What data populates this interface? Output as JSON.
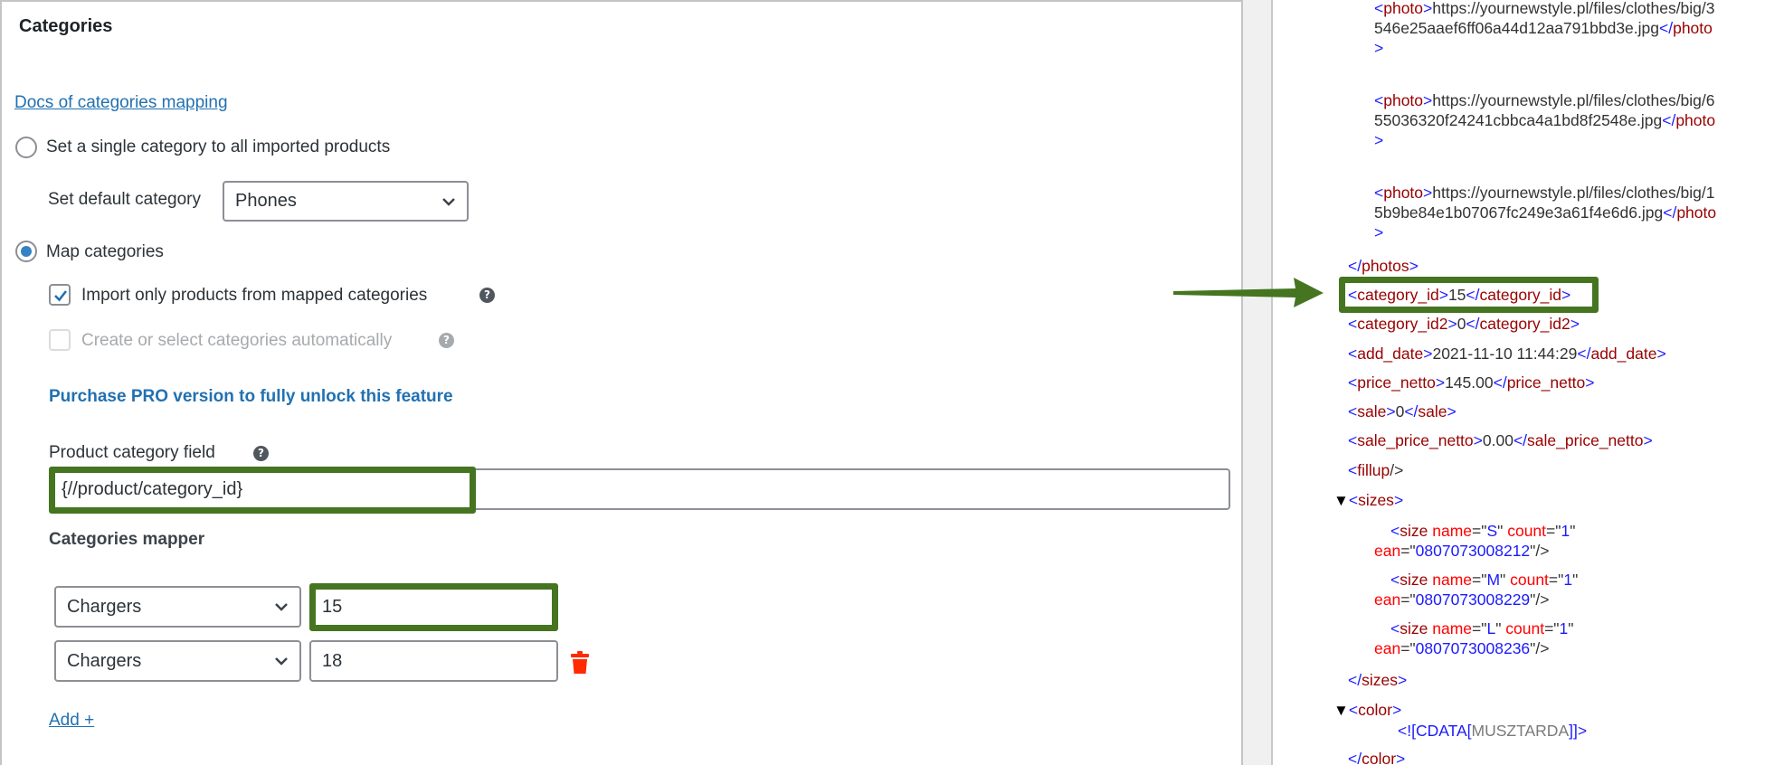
{
  "left": {
    "title": "Categories",
    "docs_link": "Docs of categories mapping",
    "radio_single": {
      "label": "Set a single category to all imported products",
      "checked": false
    },
    "default_category": {
      "label": "Set default category",
      "value": "Phones"
    },
    "radio_map": {
      "label": "Map categories",
      "checked": true
    },
    "checkbox_mapped_only": {
      "label": "Import only products from mapped categories",
      "checked": true
    },
    "checkbox_auto": {
      "label": "Create or select categories automatically",
      "checked": false,
      "disabled": true
    },
    "pro_notice": "Purchase PRO version to fully unlock this feature",
    "product_category_field": {
      "label": "Product category field",
      "value": "{//product/category_id}"
    },
    "mapper": {
      "heading": "Categories mapper",
      "rows": [
        {
          "category": "Chargers",
          "value": "15"
        },
        {
          "category": "Chargers",
          "value": "18"
        }
      ],
      "add_label": "Add +"
    },
    "help_glyph": "?"
  },
  "xml": {
    "photos": [
      {
        "tag": "photo",
        "line1": "https://yournewstyle.pl/files/clothes/big/3",
        "line2": "546e25aaef6ff06a44d12aa791bbd3e.jpg",
        "close_partial": "photo",
        "close_end": ">"
      },
      {
        "tag": "photo",
        "line1": "https://yournewstyle.pl/files/clothes/big/6",
        "line2": "55036320f24241cbbca4a1bd8f2548e.jpg",
        "close_partial": "photo",
        "close_end": ">"
      },
      {
        "tag": "photo",
        "line1": "https://yournewstyle.pl/files/clothes/big/1",
        "line2": "5b9be84e1b07067fc249e3a61f4e6d6.jpg",
        "close_partial": "photo",
        "close_end": ">"
      }
    ],
    "photos_close": "photos",
    "elements": [
      {
        "tag": "category_id",
        "value": "15"
      },
      {
        "tag": "category_id2",
        "value": "0"
      },
      {
        "tag": "add_date",
        "value": "2021-11-10 11:44:29"
      },
      {
        "tag": "price_netto",
        "value": "145.00"
      },
      {
        "tag": "sale",
        "value": "0"
      },
      {
        "tag": "sale_price_netto",
        "value": "0.00"
      }
    ],
    "fillup": "fillup",
    "sizes_tag": "sizes",
    "sizes": [
      {
        "name": "S",
        "count": "1",
        "ean": "0807073008212"
      },
      {
        "name": "M",
        "count": "1",
        "ean": "0807073008229"
      },
      {
        "name": "L",
        "count": "1",
        "ean": "0807073008236"
      }
    ],
    "color_tag": "color",
    "color_cdata": "MUSZTARDA",
    "expand_glyph": "▼"
  },
  "colors": {
    "highlight": "#457520",
    "link": "#2271b1",
    "trash": "#ff2a00"
  }
}
